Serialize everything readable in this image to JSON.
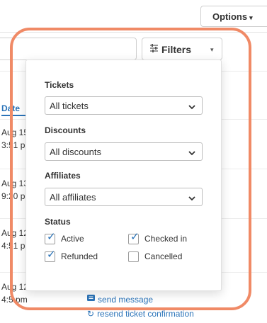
{
  "toolbar": {
    "options_label": "Options",
    "filters_label": "Filters"
  },
  "table": {
    "date_header": "Date",
    "rows": [
      {
        "date_line1": "Aug 15",
        "date_line2": "3:51 pm"
      },
      {
        "date_line1": "Aug 13",
        "date_line2": "9:20 pm"
      },
      {
        "date_line1": "Aug 12",
        "date_line2": "4:51 pm"
      },
      {
        "date_line1": "Aug 12",
        "date_line2": "4:5 pm"
      }
    ],
    "actions": {
      "send_message": "send message",
      "resend_confirmation": "resend ticket confirmation"
    }
  },
  "filters_panel": {
    "tickets": {
      "label": "Tickets",
      "value": "All tickets"
    },
    "discounts": {
      "label": "Discounts",
      "value": "All discounts"
    },
    "affiliates": {
      "label": "Affiliates",
      "value": "All affiliates"
    },
    "status": {
      "label": "Status",
      "options": [
        {
          "label": "Active",
          "checked": true
        },
        {
          "label": "Checked in",
          "checked": true
        },
        {
          "label": "Refunded",
          "checked": true
        },
        {
          "label": "Cancelled",
          "checked": false
        }
      ]
    }
  },
  "colors": {
    "accent": "#2a73b8",
    "highlight": "#f08a66"
  }
}
